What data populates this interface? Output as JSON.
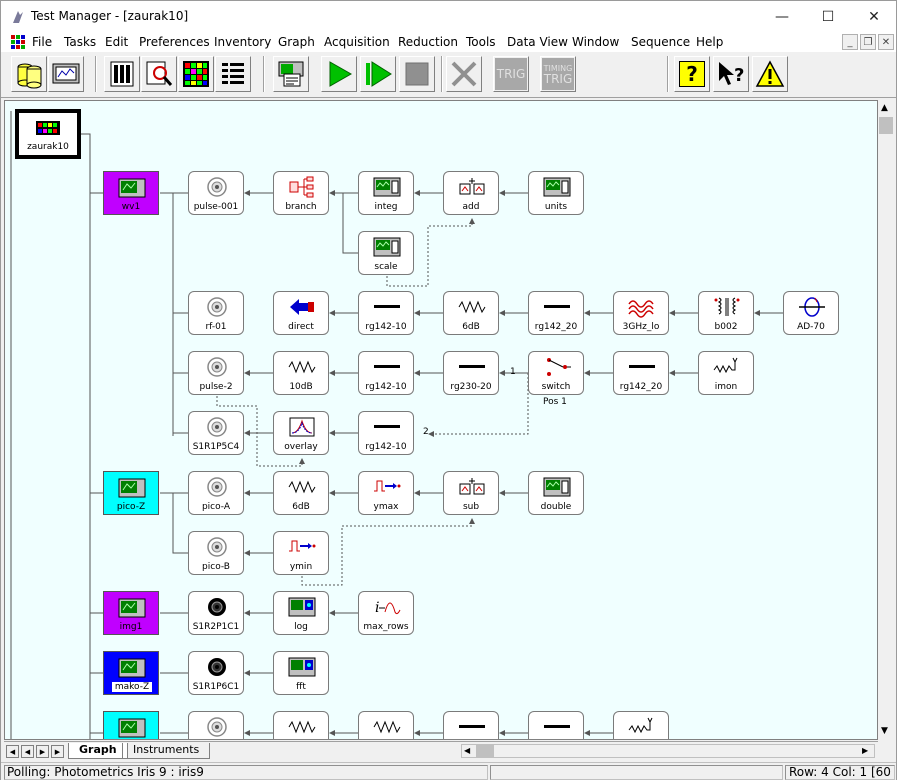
{
  "window": {
    "title": "Test Manager - [zaurak10]"
  },
  "menu": [
    "File",
    "Tasks",
    "Edit",
    "Preferences",
    "Inventory",
    "Graph",
    "Acquisition",
    "Reduction",
    "Tools",
    "Data View",
    "Window",
    "Sequence",
    "Help"
  ],
  "toolbar": {
    "trig_label": "TRIG",
    "timing_trig_label_1": "TIMING",
    "timing_trig_label_2": "TRIG",
    "help_mark": "?"
  },
  "graph": {
    "root": "zaurak10",
    "instruments": [
      {
        "id": "wv1",
        "label": "wv1",
        "color": "#c000ff"
      },
      {
        "id": "picoZ",
        "label": "pico-Z",
        "color": "#00ffff"
      },
      {
        "id": "img1",
        "label": "img1",
        "color": "#c000ff"
      },
      {
        "id": "makoZ",
        "label": "mako-Z",
        "color": "#0000ff"
      },
      {
        "id": "inst5",
        "label": "",
        "color": "#00ffff"
      }
    ],
    "nodes": {
      "pulse001": "pulse-001",
      "branch": "branch",
      "integ": "integ",
      "add": "add",
      "units": "units",
      "scale": "scale",
      "rf01": "rf-01",
      "direct": "direct",
      "rg142_10a": "rg142-10",
      "db6a": "6dB",
      "rg142_20a": "rg142_20",
      "ghz": "3GHz_lo",
      "b002": "b002",
      "ad70": "AD-70",
      "pulse2": "pulse-2",
      "db10": "10dB",
      "rg142_10b": "rg142-10",
      "rg230": "rg230-20",
      "switch": "switch",
      "rg142_20b": "rg142_20",
      "imon": "imon",
      "s1r1p5c4": "S1R1P5C4",
      "overlay": "overlay",
      "rg142_10c": "rg142-10",
      "picoA": "pico-A",
      "db6b": "6dB",
      "ymax": "ymax",
      "sub": "sub",
      "double": "double",
      "picoB": "pico-B",
      "ymin": "ymin",
      "s1r2p1c1": "S1R2P1C1",
      "log": "log",
      "maxrows": "max_rows",
      "s1r1p6c1": "S1R1P6C1",
      "fft": "fft"
    },
    "switch_state": "Pos 1",
    "port_labels": {
      "p1": "1",
      "p2": "2"
    }
  },
  "tabs": [
    {
      "label": "Graph",
      "active": true
    },
    {
      "label": "Instruments",
      "active": false
    }
  ],
  "status": {
    "left": "Polling: Photometrics Iris 9 : iris9",
    "right": "Row: 4 Col: 1  [60"
  }
}
